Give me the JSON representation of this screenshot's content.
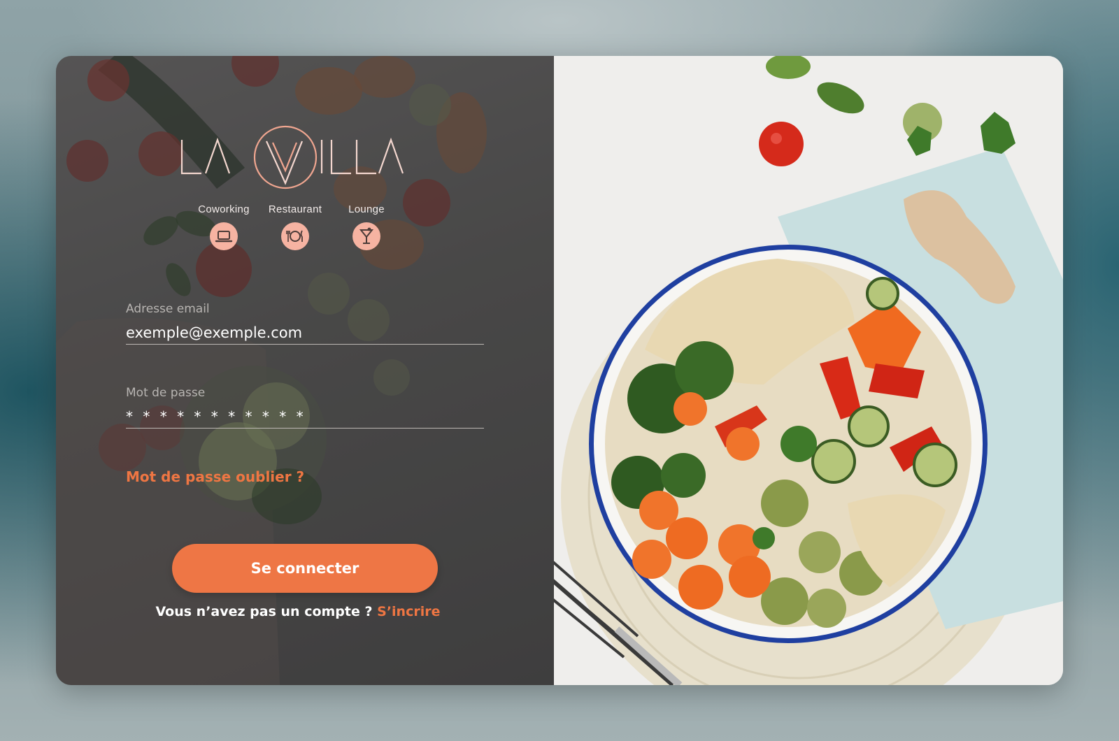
{
  "brand": {
    "logo_text": "LA VILLA",
    "accent_color": "#ef7643",
    "logo_color": "#f4d7cf"
  },
  "sections": [
    {
      "label": "Coworking",
      "icon": "laptop-icon"
    },
    {
      "label": "Restaurant",
      "icon": "plate-cutlery-icon"
    },
    {
      "label": "Lounge",
      "icon": "cocktail-glass-icon"
    }
  ],
  "form": {
    "email": {
      "label": "Adresse email",
      "value": "exemple@exemple.com"
    },
    "password": {
      "label": "Mot de passe",
      "value": "* * * * * * * * * * *"
    },
    "forgot_link": "Mot de passe oublier ?",
    "submit_label": "Se connecter",
    "signup_prompt": "Vous n’avez pas un compte ?",
    "signup_link": "S’incrire"
  },
  "colors": {
    "button": "#ee7645",
    "panel_overlay": "#4b4a49",
    "icon_circle": "#f6b3a2"
  }
}
